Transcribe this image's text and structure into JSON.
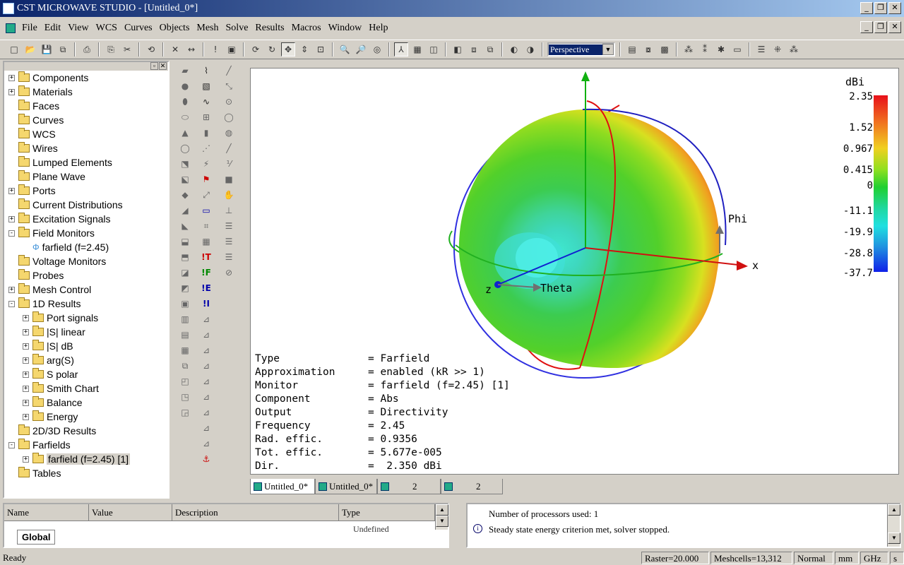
{
  "window": {
    "title": "CST MICROWAVE STUDIO - [Untitled_0*]"
  },
  "menu": [
    "File",
    "Edit",
    "View",
    "WCS",
    "Curves",
    "Objects",
    "Mesh",
    "Solve",
    "Results",
    "Macros",
    "Window",
    "Help"
  ],
  "toolbar": {
    "view_mode": "Perspective"
  },
  "tree": [
    {
      "label": "Components",
      "exp": "+",
      "level": 0,
      "type": "folder"
    },
    {
      "label": "Materials",
      "exp": "+",
      "level": 0,
      "type": "folder"
    },
    {
      "label": "Faces",
      "exp": "",
      "level": 0,
      "type": "folder"
    },
    {
      "label": "Curves",
      "exp": "",
      "level": 0,
      "type": "folder"
    },
    {
      "label": "WCS",
      "exp": "",
      "level": 0,
      "type": "folder"
    },
    {
      "label": "Wires",
      "exp": "",
      "level": 0,
      "type": "folder"
    },
    {
      "label": "Lumped Elements",
      "exp": "",
      "level": 0,
      "type": "folder"
    },
    {
      "label": "Plane Wave",
      "exp": "",
      "level": 0,
      "type": "folder"
    },
    {
      "label": "Ports",
      "exp": "+",
      "level": 0,
      "type": "folder"
    },
    {
      "label": "Current Distributions",
      "exp": "",
      "level": 0,
      "type": "folder"
    },
    {
      "label": "Excitation Signals",
      "exp": "+",
      "level": 0,
      "type": "folder"
    },
    {
      "label": "Field Monitors",
      "exp": "-",
      "level": 0,
      "type": "folder"
    },
    {
      "label": "farfield (f=2.45)",
      "exp": "",
      "level": 1,
      "type": "monitor"
    },
    {
      "label": "Voltage Monitors",
      "exp": "",
      "level": 0,
      "type": "folder"
    },
    {
      "label": "Probes",
      "exp": "",
      "level": 0,
      "type": "folder"
    },
    {
      "label": "Mesh Control",
      "exp": "+",
      "level": 0,
      "type": "folder"
    },
    {
      "label": "1D Results",
      "exp": "-",
      "level": 0,
      "type": "folder"
    },
    {
      "label": "Port signals",
      "exp": "+",
      "level": 1,
      "type": "folder"
    },
    {
      "label": "|S| linear",
      "exp": "+",
      "level": 1,
      "type": "folder"
    },
    {
      "label": "|S| dB",
      "exp": "+",
      "level": 1,
      "type": "folder"
    },
    {
      "label": "arg(S)",
      "exp": "+",
      "level": 1,
      "type": "folder"
    },
    {
      "label": "S polar",
      "exp": "+",
      "level": 1,
      "type": "folder"
    },
    {
      "label": "Smith Chart",
      "exp": "+",
      "level": 1,
      "type": "folder"
    },
    {
      "label": "Balance",
      "exp": "+",
      "level": 1,
      "type": "folder"
    },
    {
      "label": "Energy",
      "exp": "+",
      "level": 1,
      "type": "folder"
    },
    {
      "label": "2D/3D Results",
      "exp": "",
      "level": 0,
      "type": "folder"
    },
    {
      "label": "Farfields",
      "exp": "-",
      "level": 0,
      "type": "folder"
    },
    {
      "label": "farfield (f=2.45) [1]",
      "exp": "+",
      "level": 1,
      "type": "folder",
      "selected": true
    },
    {
      "label": "Tables",
      "exp": "",
      "level": 0,
      "type": "folder"
    }
  ],
  "colorbar": {
    "unit": "dBi",
    "labels": [
      "2.35",
      "1.52",
      "0.967",
      "0.415",
      "0",
      "-11.1",
      "-19.9",
      "-28.8",
      "-37.7"
    ]
  },
  "axes": {
    "x": "x",
    "z": "z",
    "phi": "Phi",
    "theta": "Theta"
  },
  "info": [
    {
      "k": "Type",
      "v": "= Farfield"
    },
    {
      "k": "Approximation",
      "v": "= enabled (kR >> 1)"
    },
    {
      "k": "Monitor",
      "v": "= farfield (f=2.45) [1]"
    },
    {
      "k": "Component",
      "v": "= Abs"
    },
    {
      "k": "Output",
      "v": "= Directivity"
    },
    {
      "k": "Frequency",
      "v": "= 2.45"
    },
    {
      "k": "Rad. effic.",
      "v": "= 0.9356"
    },
    {
      "k": "Tot. effic.",
      "v": "= 5.677e-005"
    },
    {
      "k": "Dir.",
      "v": "=  2.350 dBi"
    }
  ],
  "doc_tabs": [
    "Untitled_0*",
    "Untitled_0*",
    "2",
    "2"
  ],
  "params": {
    "headers": [
      "Name",
      "Value",
      "Description",
      "Type"
    ],
    "row_type": "Undefined",
    "tab": "Global"
  },
  "messages": [
    "Number of processors used: 1",
    "Steady state energy criterion met, solver stopped."
  ],
  "status": {
    "ready": "Ready",
    "raster": "Raster=20.000",
    "meshcells": "Meshcells=13,312",
    "mode": "Normal",
    "unit_len": "mm",
    "unit_freq": "GHz",
    "unit_time": "s"
  }
}
